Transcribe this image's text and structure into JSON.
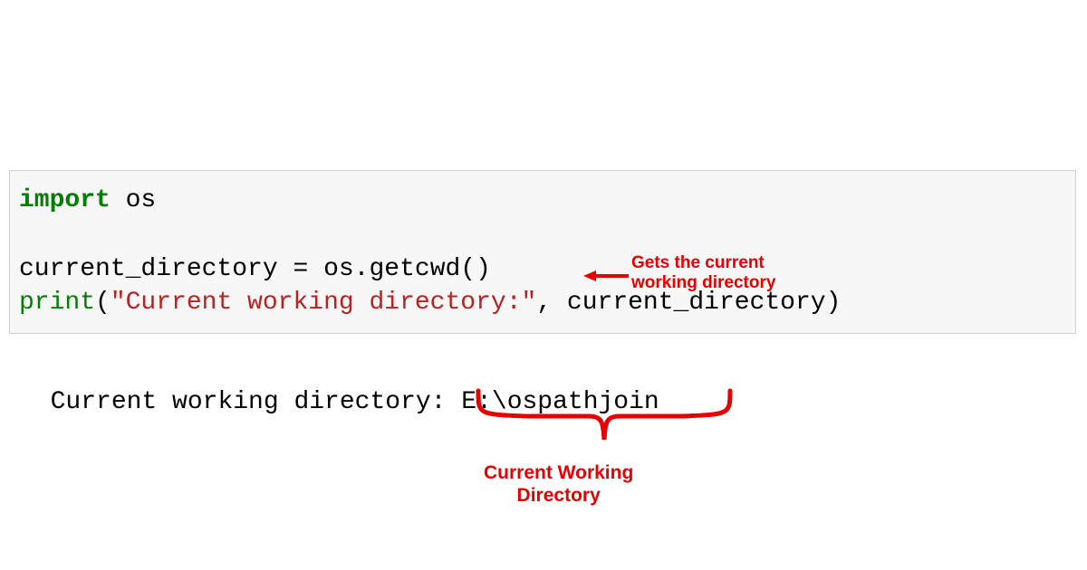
{
  "code": {
    "line1": {
      "keyword": "import",
      "module": " os"
    },
    "line2": "",
    "line3": {
      "variable": "current_directory ",
      "operator": "=",
      "call": " os.getcwd()"
    },
    "line4": {
      "builtin": "print",
      "open": "(",
      "string": "\"Current working directory:\"",
      "comma": ", current_directory",
      "close": ")"
    }
  },
  "output": {
    "text": "Current working directory: E:\\ospathjoin"
  },
  "annotations": {
    "a1_line1": "Gets the current",
    "a1_line2": "working directory",
    "a2_line1": "Current Working",
    "a2_line2": "Directory"
  }
}
